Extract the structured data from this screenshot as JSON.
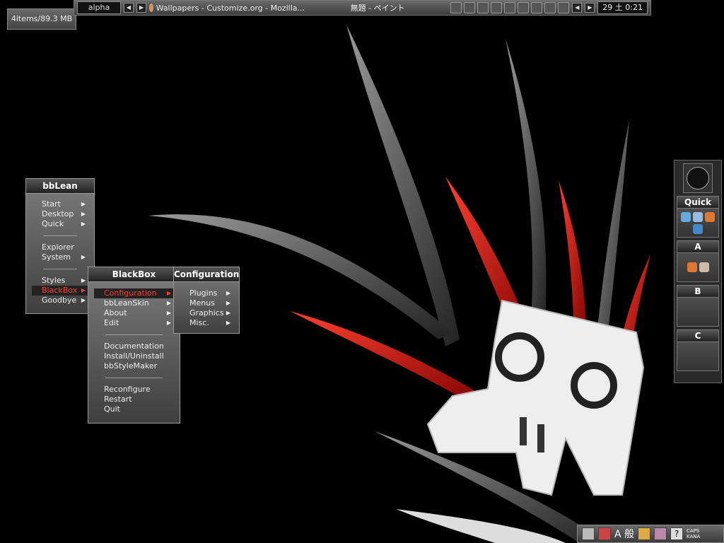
{
  "status": {
    "text": "4items/89.3 MB"
  },
  "taskbar": {
    "workspace": "alpha",
    "active_task": "Wallpapers - Customize.org - Mozilla...",
    "center_title": "無題 - ペイント",
    "clock": "29 土 0:21"
  },
  "menus": {
    "bblean": {
      "title": "bbLean",
      "items": [
        "Start",
        "Desktop",
        "Quick",
        "Explorer",
        "System",
        "Styles",
        "BlackBox",
        "Goodbye"
      ]
    },
    "blackbox": {
      "title": "BlackBox",
      "items": [
        "Configuration",
        "bbLeanSkin",
        "About",
        "Edit",
        "Documentation",
        "Install/Uninstall",
        "bbStyleMaker",
        "Reconfigure",
        "Restart",
        "Quit"
      ]
    },
    "configuration": {
      "title": "Configuration",
      "items": [
        "Plugins",
        "Menus",
        "Graphics",
        "Misc."
      ]
    }
  },
  "slit": {
    "panels": [
      "Quick",
      "A",
      "B",
      "C"
    ]
  },
  "tray": {
    "ime_text": "A 般",
    "caps": "CAPS",
    "kana": "KANA"
  },
  "colors": {
    "accent": "#ff3b30",
    "background": "#000000"
  }
}
